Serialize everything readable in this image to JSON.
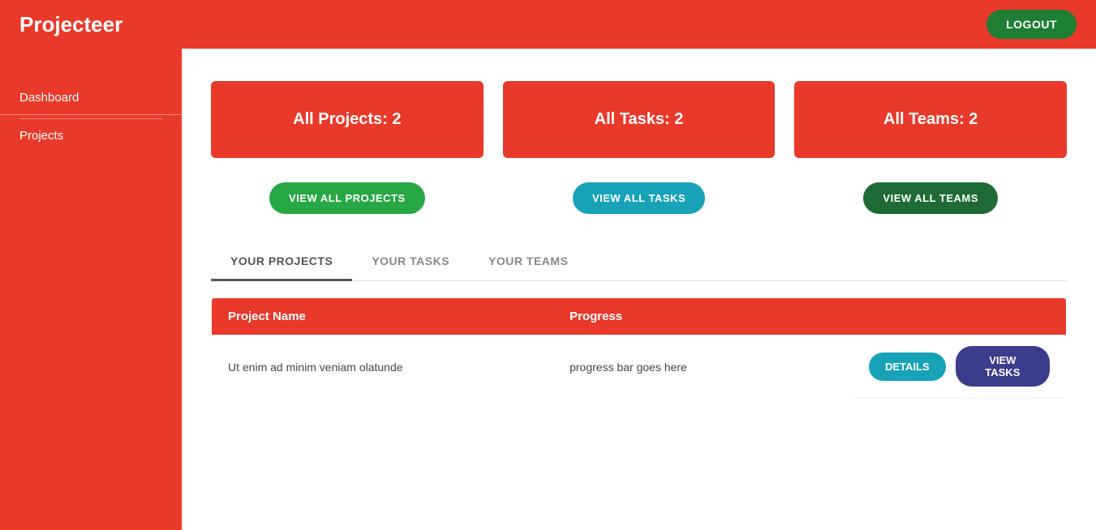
{
  "header": {
    "title": "Projecteer",
    "logout_label": "LOGOUT"
  },
  "sidebar": {
    "items": [
      {
        "label": "Dashboard",
        "active": true
      },
      {
        "label": "Projects",
        "active": false
      }
    ]
  },
  "summary": {
    "cards": [
      {
        "label": "All Projects: 2"
      },
      {
        "label": "All Tasks: 2"
      },
      {
        "label": "All Teams: 2"
      }
    ],
    "buttons": [
      {
        "label": "VIEW ALL PROJECTS",
        "style": "projects"
      },
      {
        "label": "VIEW ALL TASKS",
        "style": "tasks"
      },
      {
        "label": "VIEW ALL TEAMS",
        "style": "teams"
      }
    ]
  },
  "tabs": [
    {
      "label": "YOUR PROJECTS",
      "active": true
    },
    {
      "label": "YOUR TASKS",
      "active": false
    },
    {
      "label": "YOUR TEAMS",
      "active": false
    }
  ],
  "table": {
    "headers": [
      {
        "label": "Project Name"
      },
      {
        "label": "Progress"
      },
      {
        "label": ""
      }
    ],
    "rows": [
      {
        "project_name": "Ut enim ad minim veniam olatunde",
        "progress": "progress bar goes here",
        "details_label": "DETAILS",
        "view_tasks_label": "VIEW TASKS"
      }
    ]
  }
}
